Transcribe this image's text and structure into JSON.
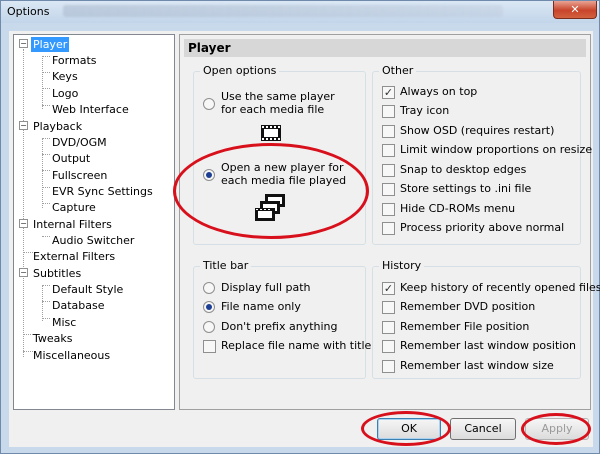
{
  "window": {
    "title": "Options",
    "close_symbol": "✕"
  },
  "tree": {
    "items": [
      {
        "label": "Player",
        "selected": true
      },
      {
        "label": "Formats"
      },
      {
        "label": "Keys"
      },
      {
        "label": "Logo"
      },
      {
        "label": "Web Interface"
      },
      {
        "label": "Playback"
      },
      {
        "label": "DVD/OGM"
      },
      {
        "label": "Output"
      },
      {
        "label": "Fullscreen"
      },
      {
        "label": "EVR Sync Settings"
      },
      {
        "label": "Capture"
      },
      {
        "label": "Internal Filters"
      },
      {
        "label": "Audio Switcher"
      },
      {
        "label": "External Filters"
      },
      {
        "label": "Subtitles"
      },
      {
        "label": "Default Style"
      },
      {
        "label": "Database"
      },
      {
        "label": "Misc"
      },
      {
        "label": "Tweaks"
      },
      {
        "label": "Miscellaneous"
      }
    ]
  },
  "panel": {
    "header": "Player",
    "open_options": {
      "label": "Open options",
      "same_player": {
        "label": "Use the same player for each media file",
        "selected": false
      },
      "new_player": {
        "label": "Open a new player for each media file played",
        "selected": true
      }
    },
    "other": {
      "label": "Other",
      "items": [
        {
          "label": "Always on top",
          "checked": true
        },
        {
          "label": "Tray icon",
          "checked": false
        },
        {
          "label": "Show OSD (requires restart)",
          "checked": false
        },
        {
          "label": "Limit window proportions on resize",
          "checked": false
        },
        {
          "label": "Snap to desktop edges",
          "checked": false
        },
        {
          "label": "Store settings to .ini file",
          "checked": false
        },
        {
          "label": "Hide CD-ROMs menu",
          "checked": false
        },
        {
          "label": "Process priority above normal",
          "checked": false
        }
      ]
    },
    "title_bar": {
      "label": "Title bar",
      "radios": [
        {
          "label": "Display full path",
          "selected": false
        },
        {
          "label": "File name only",
          "selected": true
        },
        {
          "label": "Don't prefix anything",
          "selected": false
        }
      ],
      "replace": {
        "label": "Replace file name with title",
        "checked": false
      }
    },
    "history": {
      "label": "History",
      "items": [
        {
          "label": "Keep history of recently opened files",
          "checked": true
        },
        {
          "label": "Remember DVD position",
          "checked": false
        },
        {
          "label": "Remember File position",
          "checked": false
        },
        {
          "label": "Remember last window position",
          "checked": false
        },
        {
          "label": "Remember last window size",
          "checked": false
        }
      ]
    }
  },
  "buttons": {
    "ok": "OK",
    "cancel": "Cancel",
    "apply": "Apply"
  },
  "check_symbol": "✓",
  "colors": {
    "highlight_ring": "#d8101c",
    "selection": "#3399ff"
  },
  "icons": {
    "film": "film-strip-icon",
    "films": "film-stack-icon",
    "close": "close-icon"
  }
}
